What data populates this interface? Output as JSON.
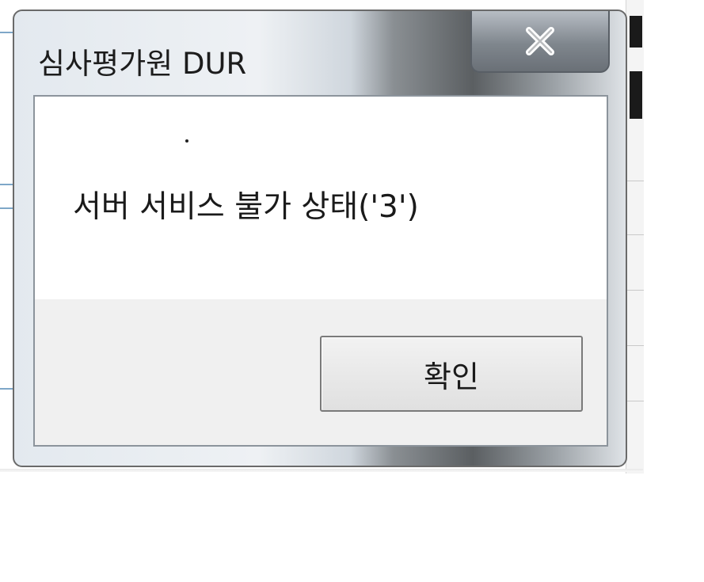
{
  "dialog": {
    "title": "심사평가원 DUR",
    "close_icon": "close-icon",
    "message": "서버 서비스 불가 상태('3')",
    "ok_label": "확인"
  },
  "colors": {
    "title_text": "#1c1c1c",
    "client_background": "#f0f0f0",
    "message_background": "#ffffff",
    "button_border": "#7a7a7a"
  }
}
